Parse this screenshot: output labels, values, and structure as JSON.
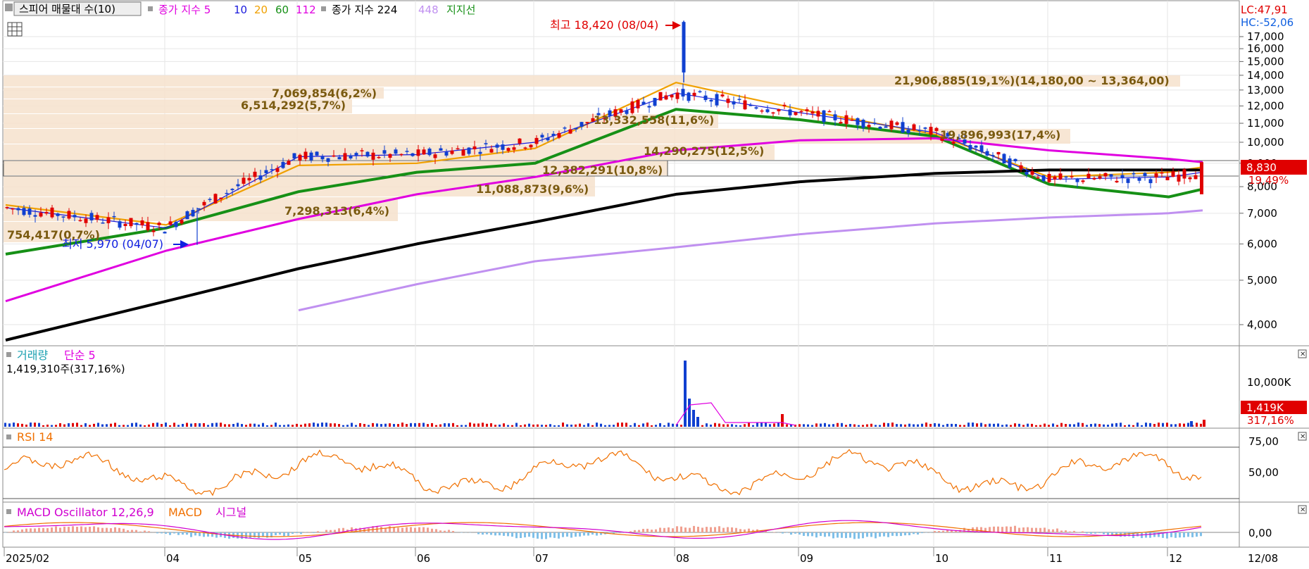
{
  "toolbar": {
    "indicator_button": "스피어 매물대 수(10)",
    "ma_label": "종가 지수 5",
    "ma_periods": [
      "10",
      "20",
      "60",
      "112"
    ],
    "ma_colors": [
      "#1a1adc",
      "#f0a000",
      "#169016",
      "#e000e0"
    ],
    "ma2_label": "종가 지수 224",
    "ma2_period": "448",
    "support_label": "지지선"
  },
  "top_right": {
    "lc": "LC:47,91",
    "hc": "HC:-52,06"
  },
  "price_panel": {
    "y_ticks": [
      "17,000",
      "16,000",
      "15,000",
      "14,000",
      "13,000",
      "12,000",
      "11,000",
      "10,000",
      "9,000",
      "8,000",
      "7,000",
      "6,000",
      "5,000",
      "4,000"
    ],
    "current_price": "8,830",
    "current_change": "19,49%",
    "high_note": "최고 18,420 (08/04)",
    "low_note": "최저 5,970 (04/07)",
    "volume_profile": [
      {
        "label": "21,906,885(19,1%)(14,180,00 ~ 13,364,00)",
        "price_low": 13364,
        "price_high": 14180,
        "pct": 19.1
      },
      {
        "label": "7,069,854(6,2%)",
        "pct": 6.2
      },
      {
        "label": "6,514,292(5,7%)",
        "pct": 5.7
      },
      {
        "label": "13,332,558(11,6%)",
        "pct": 11.6
      },
      {
        "label": "19,896,993(17,4%)",
        "pct": 17.4
      },
      {
        "label": "14,290,275(12,5%)",
        "pct": 12.5
      },
      {
        "label": "12,382,291(10,8%)",
        "pct": 10.8
      },
      {
        "label": "11,088,873(9,6%)",
        "pct": 9.6
      },
      {
        "label": "7,298,313(6,4%)",
        "pct": 6.4
      },
      {
        "label": "754,417(0,7%)",
        "pct": 0.7
      }
    ]
  },
  "volume_panel": {
    "title": "거래량",
    "ma_label": "단순 5",
    "value": "1,419,310주(317,16%)",
    "tick": "10,000K",
    "current": "1,419K",
    "current_pct": "317,16%"
  },
  "rsi_panel": {
    "title": "RSI 14",
    "ticks": [
      "75,00",
      "50,00"
    ]
  },
  "macd_panel": {
    "title": "MACD Oscillator 12,26,9",
    "macd_label": "MACD",
    "signal_label": "시그널",
    "tick": "0,00"
  },
  "x_axis": {
    "labels": [
      "2025/02",
      "04",
      "05",
      "06",
      "07",
      "08",
      "09",
      "10",
      "11",
      "12"
    ],
    "right_label": "12/08"
  },
  "chart_data": {
    "type": "line",
    "x": [
      "2025/02",
      "04",
      "05",
      "06",
      "07",
      "08",
      "09",
      "10",
      "11",
      "12",
      "12/08"
    ],
    "series": [
      {
        "values": [
          7300,
          6600,
          8900,
          9000,
          9700,
          13500,
          11800,
          10400,
          8400,
          8600,
          8830
        ]
      },
      {
        "values": [
          5700,
          6500,
          7800,
          8600,
          9000,
          11800,
          11200,
          10300,
          8100,
          7600,
          7900
        ]
      },
      {
        "values": [
          4500,
          5800,
          6800,
          7700,
          8400,
          9600,
          10100,
          10200,
          9600,
          9200,
          9050
        ]
      },
      {
        "values": [
          3700,
          4500,
          5300,
          6000,
          6700,
          7700,
          8200,
          8550,
          8700,
          8700,
          8700
        ]
      },
      {
        "values": [
          null,
          null,
          4300,
          4900,
          5500,
          5900,
          6300,
          6650,
          6850,
          7000,
          7100
        ]
      }
    ],
    "ylim": [
      3600,
      18500
    ],
    "high": {
      "price": 18420,
      "date": "08/04"
    },
    "low": {
      "price": 5970,
      "date": "04/07"
    }
  }
}
